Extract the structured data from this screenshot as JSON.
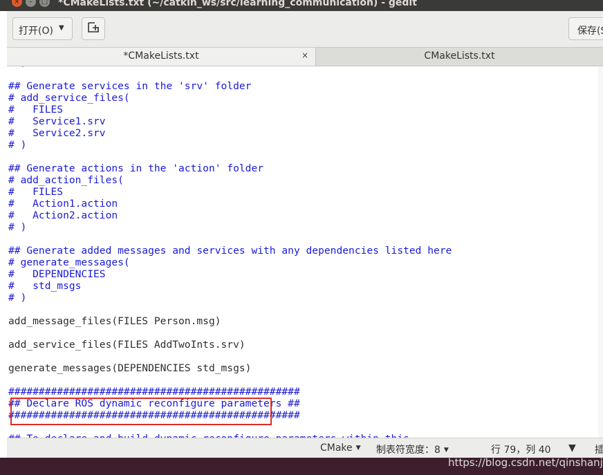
{
  "window": {
    "title": "*CMakeLists.txt (~/catkin_ws/src/learning_communication) - gedit",
    "close_glyph": "×",
    "min_glyph": "–",
    "max_glyph": "□"
  },
  "toolbar": {
    "open_label": "打开(O)",
    "open_arrow": "▼",
    "save_label": "保存(S"
  },
  "tabs": [
    {
      "label": "*CMakeLists.txt",
      "active": true,
      "close": "×"
    },
    {
      "label": "CMakeLists.txt",
      "active": false
    }
  ],
  "editor": {
    "lines": [
      {
        "text": "# )",
        "kind": "comment"
      },
      {
        "text": "",
        "kind": "plain"
      },
      {
        "text": "## Generate services in the 'srv' folder",
        "kind": "comment"
      },
      {
        "text": "# add_service_files(",
        "kind": "comment"
      },
      {
        "text": "#   FILES",
        "kind": "comment"
      },
      {
        "text": "#   Service1.srv",
        "kind": "comment"
      },
      {
        "text": "#   Service2.srv",
        "kind": "comment"
      },
      {
        "text": "# )",
        "kind": "comment"
      },
      {
        "text": "",
        "kind": "plain"
      },
      {
        "text": "## Generate actions in the 'action' folder",
        "kind": "comment"
      },
      {
        "text": "# add_action_files(",
        "kind": "comment"
      },
      {
        "text": "#   FILES",
        "kind": "comment"
      },
      {
        "text": "#   Action1.action",
        "kind": "comment"
      },
      {
        "text": "#   Action2.action",
        "kind": "comment"
      },
      {
        "text": "# )",
        "kind": "comment"
      },
      {
        "text": "",
        "kind": "plain"
      },
      {
        "text": "## Generate added messages and services with any dependencies listed here",
        "kind": "comment"
      },
      {
        "text": "# generate_messages(",
        "kind": "comment"
      },
      {
        "text": "#   DEPENDENCIES",
        "kind": "comment"
      },
      {
        "text": "#   std_msgs",
        "kind": "comment"
      },
      {
        "text": "# )",
        "kind": "comment"
      },
      {
        "text": "",
        "kind": "plain"
      },
      {
        "text": "add_message_files(FILES Person.msg)",
        "kind": "plain"
      },
      {
        "text": "",
        "kind": "plain"
      },
      {
        "text": "add_service_files(FILES AddTwoInts.srv)",
        "kind": "plain"
      },
      {
        "text": "",
        "kind": "plain"
      },
      {
        "text": "generate_messages(DEPENDENCIES std_msgs)",
        "kind": "plain"
      },
      {
        "text": "",
        "kind": "plain"
      },
      {
        "text": "################################################",
        "kind": "comment"
      },
      {
        "text": "## Declare ROS dynamic reconfigure parameters ##",
        "kind": "comment"
      },
      {
        "text": "################################################",
        "kind": "comment"
      },
      {
        "text": "",
        "kind": "plain"
      },
      {
        "text": "## To declare and build dynamic reconfigure parameters within this",
        "kind": "comment"
      }
    ]
  },
  "status": {
    "language": "CMake",
    "tab_width": "制表符宽度：8",
    "position": "行 79，列 40",
    "insert_mode": "插",
    "dropdown_glyph": "▼"
  },
  "watermark": "https://blog.csdn.net/qinshanjy",
  "colors": {
    "comment": "#1a1ad6",
    "code": "#2e2e2e",
    "highlight_box": "#e02a24",
    "titlebar": "#3a3a38",
    "close_button": "#e25a2a"
  }
}
